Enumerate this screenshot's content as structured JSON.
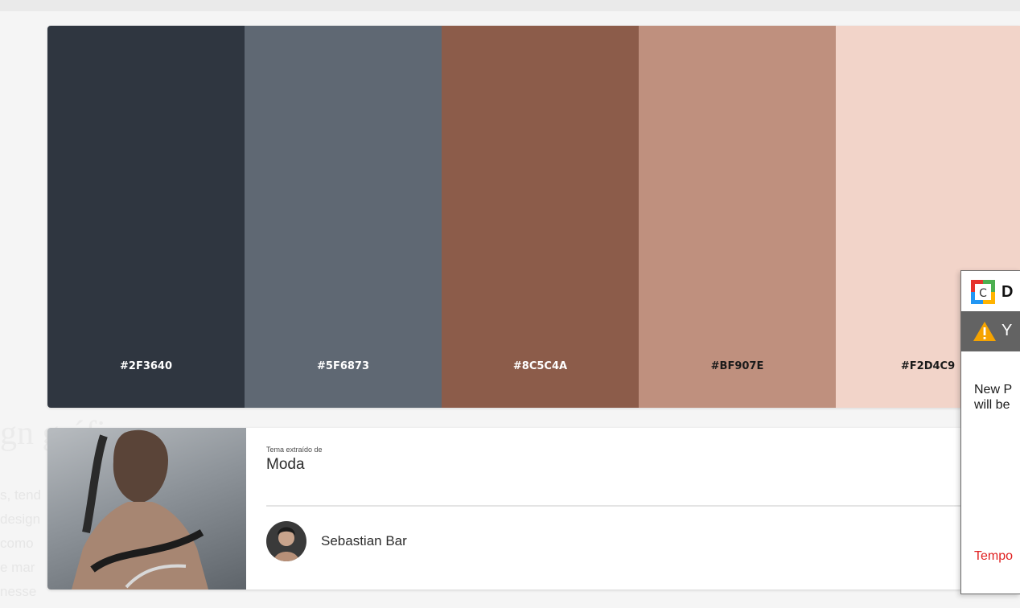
{
  "background": {
    "heading": "gn gráfi",
    "lines": [
      "s, tend",
      "design",
      "como",
      "e mar",
      "nesse"
    ]
  },
  "palette": {
    "swatches": [
      {
        "hex": "#2F3640",
        "color": "#2F3640",
        "text_color": "#ffffff"
      },
      {
        "hex": "#5F6873",
        "color": "#5F6873",
        "text_color": "#ffffff"
      },
      {
        "hex": "#8C5C4A",
        "color": "#8C5C4A",
        "text_color": "#ffffff"
      },
      {
        "hex": "#BF907E",
        "color": "#BF907E",
        "text_color": "#1b1b1b"
      },
      {
        "hex": "#F2D4C9",
        "color": "#F2D4C9",
        "text_color": "#1b1b1b"
      }
    ]
  },
  "card": {
    "label": "Tema extraído de",
    "title": "Moda",
    "author": "Sebastian Bar"
  },
  "popup": {
    "title": "D",
    "warning_text": "Y",
    "body_line1": "New P",
    "body_line2": "will be",
    "red_text": "Tempo",
    "warning_color": "#f5a300",
    "alert_color": "#e02020"
  }
}
